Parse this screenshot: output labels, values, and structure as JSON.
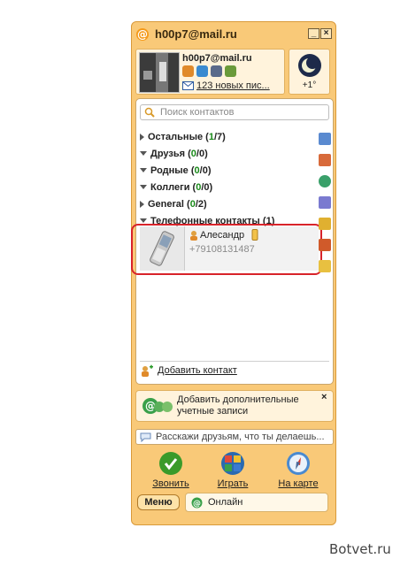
{
  "window": {
    "title": "h00p7@mail.ru",
    "minimize_label": "_",
    "close_label": "×"
  },
  "profile": {
    "email": "h00p7@mail.ru",
    "mail_link": "123 новых пис...",
    "weather_temp": "+1°"
  },
  "search": {
    "placeholder": "Поиск контактов"
  },
  "groups": [
    {
      "name": "Остальные",
      "count_open": " (",
      "count_a": "1",
      "count_b": "/7",
      "count_close": ")",
      "expanded": false
    },
    {
      "name": "Друзья",
      "count_open": " (",
      "count_a": "0",
      "count_b": "/0",
      "count_close": ")",
      "expanded": true
    },
    {
      "name": "Родные",
      "count_open": " (",
      "count_a": "0",
      "count_b": "/0",
      "count_close": ")",
      "expanded": true
    },
    {
      "name": "Коллеги",
      "count_open": " (",
      "count_a": "0",
      "count_b": "/0",
      "count_close": ")",
      "expanded": true
    },
    {
      "name": "General",
      "count_open": " (",
      "count_a": "0",
      "count_b": "/2",
      "count_close": ")",
      "expanded": false
    },
    {
      "name": "Телефонные контакты",
      "count_open": " (",
      "count_a": "1",
      "count_b": "",
      "count_close": ")",
      "expanded": true
    }
  ],
  "contact": {
    "name": "Алесандр",
    "phone": "+79108131487"
  },
  "add_contact": {
    "label": "Добавить контакт"
  },
  "accounts": {
    "text": "Добавить дополнительные учетные записи",
    "close": "×"
  },
  "status_message": {
    "placeholder": "Расскажи друзьям, что ты делаешь..."
  },
  "actions": [
    {
      "label": "Звонить",
      "color": "#3a9a2a"
    },
    {
      "label": "Играть",
      "color": "#2a6ab0"
    },
    {
      "label": "На карте",
      "color": "#4a8ad0"
    }
  ],
  "menu": {
    "label": "Меню"
  },
  "status": {
    "label": "Онлайн"
  },
  "watermark": "Botvet.ru",
  "colors": {
    "frame": "#f9c978",
    "accent_green": "#1a8a1a",
    "highlight_red": "#d8232a"
  }
}
